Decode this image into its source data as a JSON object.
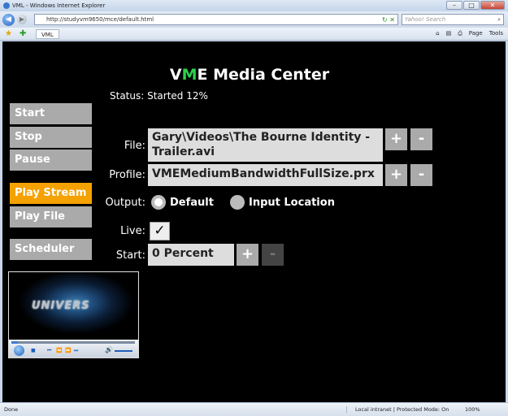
{
  "browser": {
    "window_title": "VML - Windows Internet Explorer",
    "address": "http://studyvm9650/mce/default.html",
    "search_placeholder": "Yahoo! Search",
    "tab_label": "VML",
    "tools": {
      "page": "Page",
      "tools": "Tools"
    },
    "status_text": "Done",
    "zone_text": "Local intranet | Protected Mode: On",
    "zoom": "100%"
  },
  "app": {
    "title_prefix": "V",
    "title_accent": "M",
    "title_suffix": "E Media Center",
    "status": "Status: Started 12%"
  },
  "menu": {
    "items": [
      {
        "label": "Start"
      },
      {
        "label": "Stop"
      },
      {
        "label": "Pause"
      },
      {
        "label": "Play Stream"
      },
      {
        "label": "Play File"
      },
      {
        "label": "Scheduler"
      }
    ],
    "active": "Play Stream"
  },
  "player": {
    "overlay_text": "UNIVERS",
    "progress": 0.05
  },
  "form": {
    "file_label": "File:",
    "file_value": "Gary\\Videos\\The Bourne Identity - Trailer.avi",
    "profile_label": "Profile:",
    "profile_value": "VMEMediumBandwidthFullSize.prx",
    "output_label": "Output:",
    "output_default": "Default",
    "output_input_location": "Input Location",
    "output_selected": "Default",
    "live_label": "Live:",
    "live_checked": true,
    "live_check_glyph": "✓",
    "start_label": "Start:",
    "start_value": "0 Percent",
    "plus": "+",
    "minus": "-"
  },
  "colors": {
    "accent_green": "#2ad24b",
    "active_menu": "#f5a100",
    "button_gray": "#aaaaaa"
  }
}
